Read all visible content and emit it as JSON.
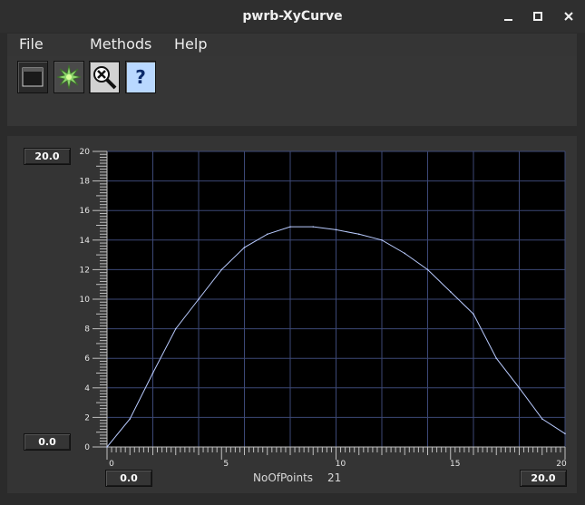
{
  "window": {
    "title": "pwrb-XyCurve"
  },
  "menu": {
    "file": "File",
    "methods": "Methods",
    "help": "Help"
  },
  "toolbar": {
    "help_glyph": "?"
  },
  "plot": {
    "ymax": "20.0",
    "ymin": "0.0",
    "xmin": "0.0",
    "xmax": "20.0",
    "count_label": "NoOfPoints",
    "count_value": "21",
    "colors": {
      "background": "#000000",
      "grid": "#3c4876",
      "curve": "#b9cbff",
      "axis_text": "#e6e6e6"
    }
  },
  "chart_data": {
    "type": "line",
    "x": [
      0,
      1,
      2,
      3,
      4,
      5,
      6,
      7,
      8,
      9,
      10,
      11,
      12,
      13,
      14,
      15,
      16,
      17,
      18,
      19,
      20
    ],
    "y": [
      0,
      1.9,
      5.0,
      8.0,
      10.0,
      12.0,
      13.5,
      14.4,
      14.9,
      14.9,
      14.7,
      14.4,
      14.0,
      13.1,
      12.0,
      10.5,
      9.0,
      6.0,
      4.0,
      1.9,
      0.9
    ],
    "xlim": [
      0,
      20
    ],
    "ylim": [
      0,
      20
    ],
    "xticks_major": [
      0,
      5,
      10,
      15,
      20
    ],
    "yticks_major": [
      0,
      2,
      4,
      6,
      8,
      10,
      12,
      14,
      16,
      18,
      20
    ],
    "grid": true
  }
}
